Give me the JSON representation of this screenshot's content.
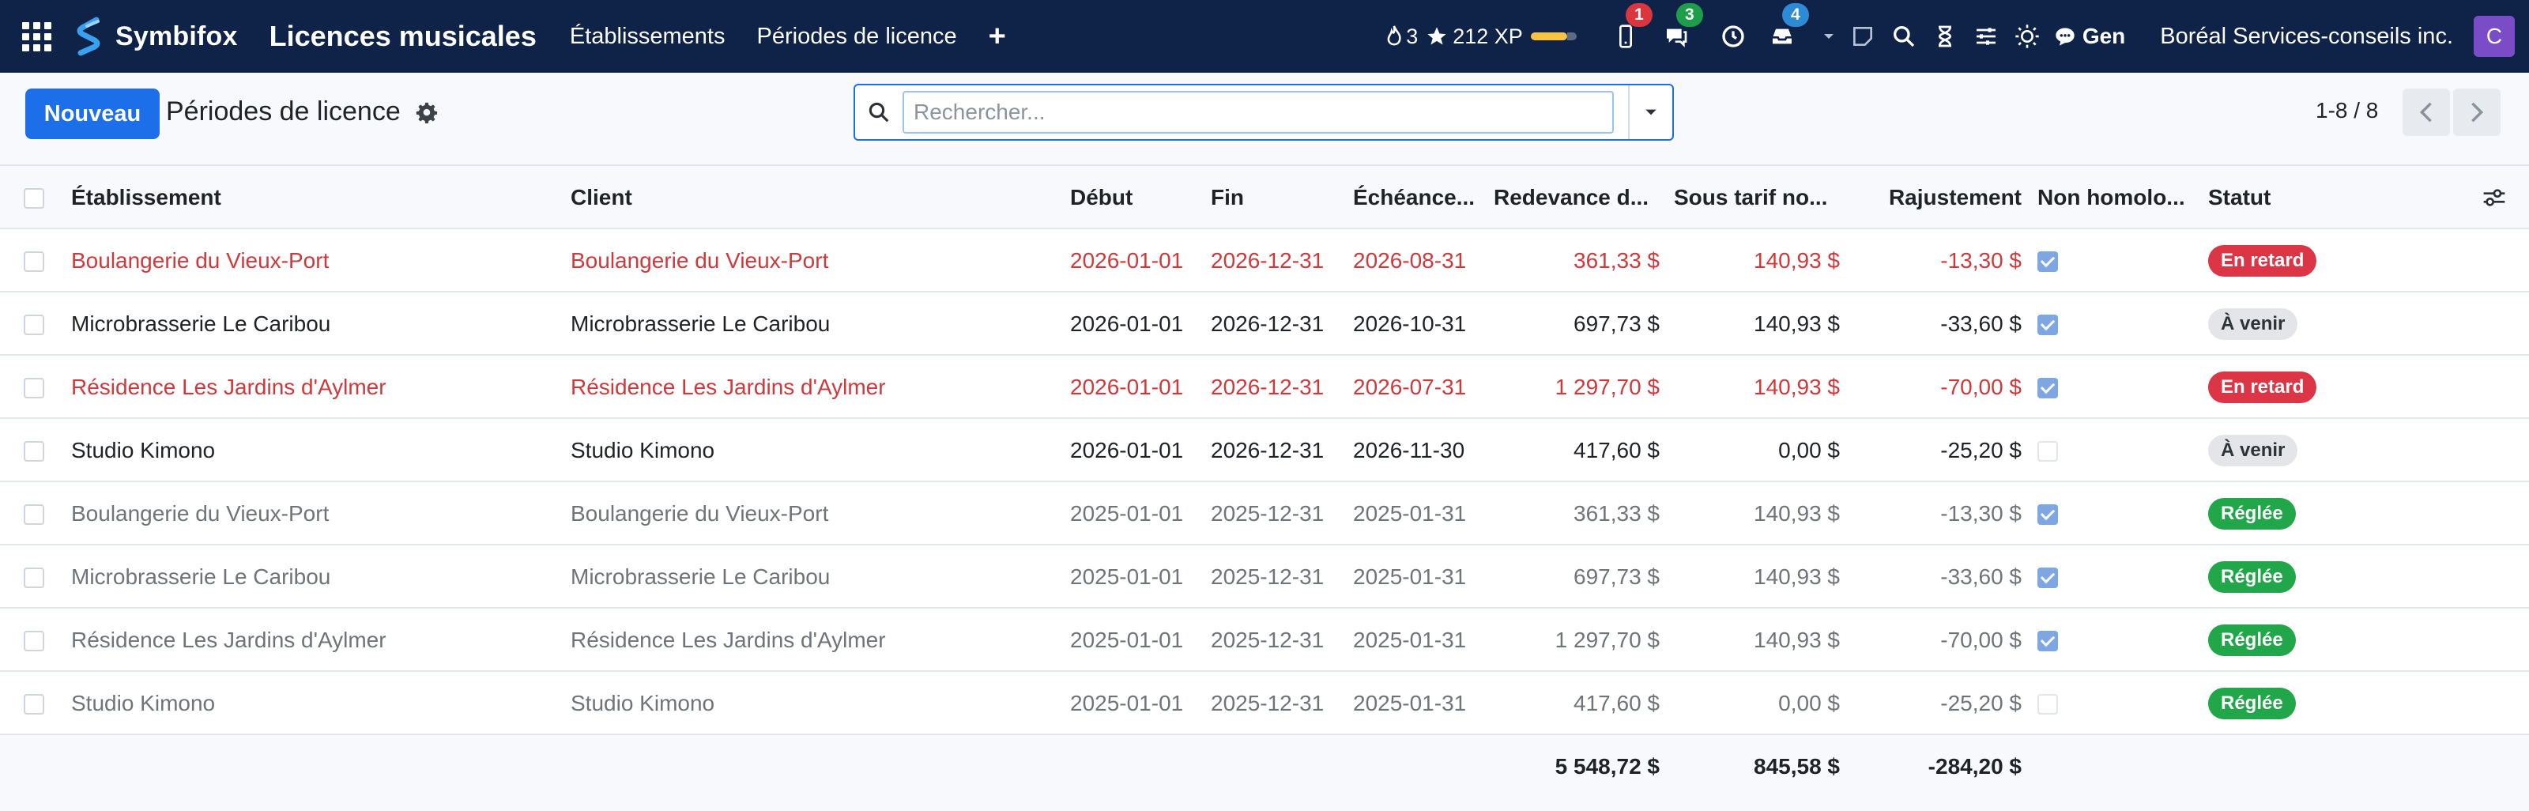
{
  "brand": {
    "name": "Symbifox"
  },
  "nav": {
    "app_title": "Licences musicales",
    "items": [
      "Établissements",
      "Périodes de licence"
    ],
    "plus": "+"
  },
  "system": {
    "streak_count": "3",
    "xp_text": "212 XP",
    "badges": {
      "phone": "1",
      "chat": "3",
      "inbox": "4"
    },
    "language": "Gen",
    "company": "Boréal Services-conseils inc.",
    "avatar_initial": "C"
  },
  "controls": {
    "new_label": "Nouveau",
    "title": "Périodes de licence",
    "search_placeholder": "Rechercher...",
    "pager_text": "1-8 / 8"
  },
  "table": {
    "headers": [
      "Établissement",
      "Client",
      "Début",
      "Fin",
      "Échéance...",
      "Redevance d...",
      "Sous tarif no...",
      "Rajustement",
      "Non homolo...",
      "Statut"
    ],
    "rows": [
      {
        "state": "late",
        "etab": "Boulangerie du Vieux-Port",
        "client": "Boulangerie du Vieux-Port",
        "debut": "2026-01-01",
        "fin": "2026-12-31",
        "echeance": "2026-08-31",
        "redevance": "361,33 $",
        "sous_tarif": "140,93 $",
        "rajustement": "-13,30 $",
        "non_homolog": true,
        "statut": "En retard",
        "statut_kind": "late"
      },
      {
        "state": "normal",
        "etab": "Microbrasserie Le Caribou",
        "client": "Microbrasserie Le Caribou",
        "debut": "2026-01-01",
        "fin": "2026-12-31",
        "echeance": "2026-10-31",
        "redevance": "697,73 $",
        "sous_tarif": "140,93 $",
        "rajustement": "-33,60 $",
        "non_homolog": true,
        "statut": "À venir",
        "statut_kind": "upcoming"
      },
      {
        "state": "late",
        "etab": "Résidence Les Jardins d'Aylmer",
        "client": "Résidence Les Jardins d'Aylmer",
        "debut": "2026-01-01",
        "fin": "2026-12-31",
        "echeance": "2026-07-31",
        "redevance": "1 297,70 $",
        "sous_tarif": "140,93 $",
        "rajustement": "-70,00 $",
        "non_homolog": true,
        "statut": "En retard",
        "statut_kind": "late"
      },
      {
        "state": "normal",
        "etab": "Studio Kimono",
        "client": "Studio Kimono",
        "debut": "2026-01-01",
        "fin": "2026-12-31",
        "echeance": "2026-11-30",
        "redevance": "417,60 $",
        "sous_tarif": "0,00 $",
        "rajustement": "-25,20 $",
        "non_homolog": false,
        "statut": "À venir",
        "statut_kind": "upcoming"
      },
      {
        "state": "past",
        "etab": "Boulangerie du Vieux-Port",
        "client": "Boulangerie du Vieux-Port",
        "debut": "2025-01-01",
        "fin": "2025-12-31",
        "echeance": "2025-01-31",
        "redevance": "361,33 $",
        "sous_tarif": "140,93 $",
        "rajustement": "-13,30 $",
        "non_homolog": true,
        "statut": "Réglée",
        "statut_kind": "paid"
      },
      {
        "state": "past",
        "etab": "Microbrasserie Le Caribou",
        "client": "Microbrasserie Le Caribou",
        "debut": "2025-01-01",
        "fin": "2025-12-31",
        "echeance": "2025-01-31",
        "redevance": "697,73 $",
        "sous_tarif": "140,93 $",
        "rajustement": "-33,60 $",
        "non_homolog": true,
        "statut": "Réglée",
        "statut_kind": "paid"
      },
      {
        "state": "past",
        "etab": "Résidence Les Jardins d'Aylmer",
        "client": "Résidence Les Jardins d'Aylmer",
        "debut": "2025-01-01",
        "fin": "2025-12-31",
        "echeance": "2025-01-31",
        "redevance": "1 297,70 $",
        "sous_tarif": "140,93 $",
        "rajustement": "-70,00 $",
        "non_homolog": true,
        "statut": "Réglée",
        "statut_kind": "paid"
      },
      {
        "state": "past",
        "etab": "Studio Kimono",
        "client": "Studio Kimono",
        "debut": "2025-01-01",
        "fin": "2025-12-31",
        "echeance": "2025-01-31",
        "redevance": "417,60 $",
        "sous_tarif": "0,00 $",
        "rajustement": "-25,20 $",
        "non_homolog": false,
        "statut": "Réglée",
        "statut_kind": "paid"
      }
    ],
    "totals": {
      "redevance": "5 548,72 $",
      "sous_tarif": "845,58 $",
      "rajustement": "-284,20 $"
    }
  },
  "colors": {
    "topbar": "#0f2348",
    "primary": "#1c6fe8",
    "late": "#d0393b",
    "paid": "#22a64a"
  }
}
